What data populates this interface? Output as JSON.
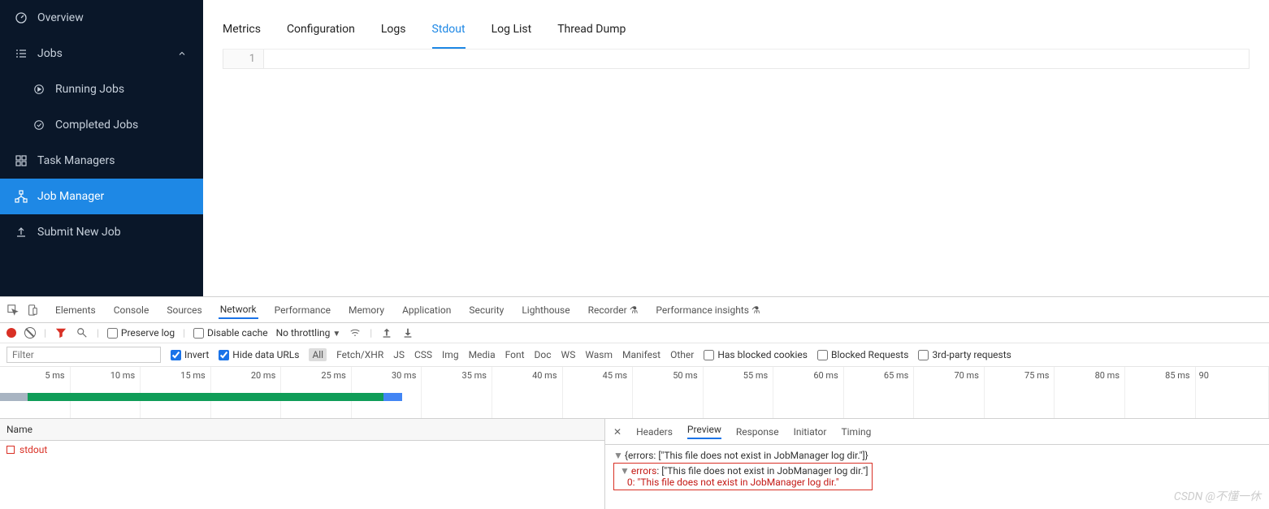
{
  "sidebar": {
    "overview": "Overview",
    "jobs": "Jobs",
    "running": "Running Jobs",
    "completed": "Completed Jobs",
    "taskmanagers": "Task Managers",
    "jobmanager": "Job Manager",
    "submit": "Submit New Job"
  },
  "tabs": {
    "metrics": "Metrics",
    "configuration": "Configuration",
    "logs": "Logs",
    "stdout": "Stdout",
    "loglist": "Log List",
    "threaddump": "Thread Dump"
  },
  "editor": {
    "line1": "1"
  },
  "devtools": {
    "tabs": {
      "elements": "Elements",
      "console": "Console",
      "sources": "Sources",
      "network": "Network",
      "performance": "Performance",
      "memory": "Memory",
      "application": "Application",
      "security": "Security",
      "lighthouse": "Lighthouse",
      "recorder": "Recorder",
      "perfinsights": "Performance insights"
    },
    "row2": {
      "preservelog": "Preserve log",
      "disablecache": "Disable cache",
      "throttling": "No throttling"
    },
    "row3": {
      "filter_ph": "Filter",
      "invert": "Invert",
      "hidedata": "Hide data URLs",
      "all": "All",
      "fetch": "Fetch/XHR",
      "js": "JS",
      "css": "CSS",
      "img": "Img",
      "media": "Media",
      "font": "Font",
      "doc": "Doc",
      "ws": "WS",
      "wasm": "Wasm",
      "manifest": "Manifest",
      "other": "Other",
      "blockedcookies": "Has blocked cookies",
      "blockedreq": "Blocked Requests",
      "thirdparty": "3rd-party requests"
    },
    "timeline": [
      "5 ms",
      "10 ms",
      "15 ms",
      "20 ms",
      "25 ms",
      "30 ms",
      "35 ms",
      "40 ms",
      "45 ms",
      "50 ms",
      "55 ms",
      "60 ms",
      "65 ms",
      "70 ms",
      "75 ms",
      "80 ms",
      "85 ms",
      "90"
    ],
    "name_header": "Name",
    "request_name": "stdout",
    "subtabs": {
      "headers": "Headers",
      "preview": "Preview",
      "response": "Response",
      "initiator": "Initiator",
      "timing": "Timing"
    },
    "preview": {
      "l1": "{errors: [\"This file does not exist in JobManager log dir.\"]}",
      "l2_key": "errors",
      "l2_rest": ": [\"This file does not exist in JobManager log dir.\"]",
      "l3": "0: \"This file does not exist in JobManager log dir.\""
    }
  },
  "watermark": "CSDN @不懂一休"
}
